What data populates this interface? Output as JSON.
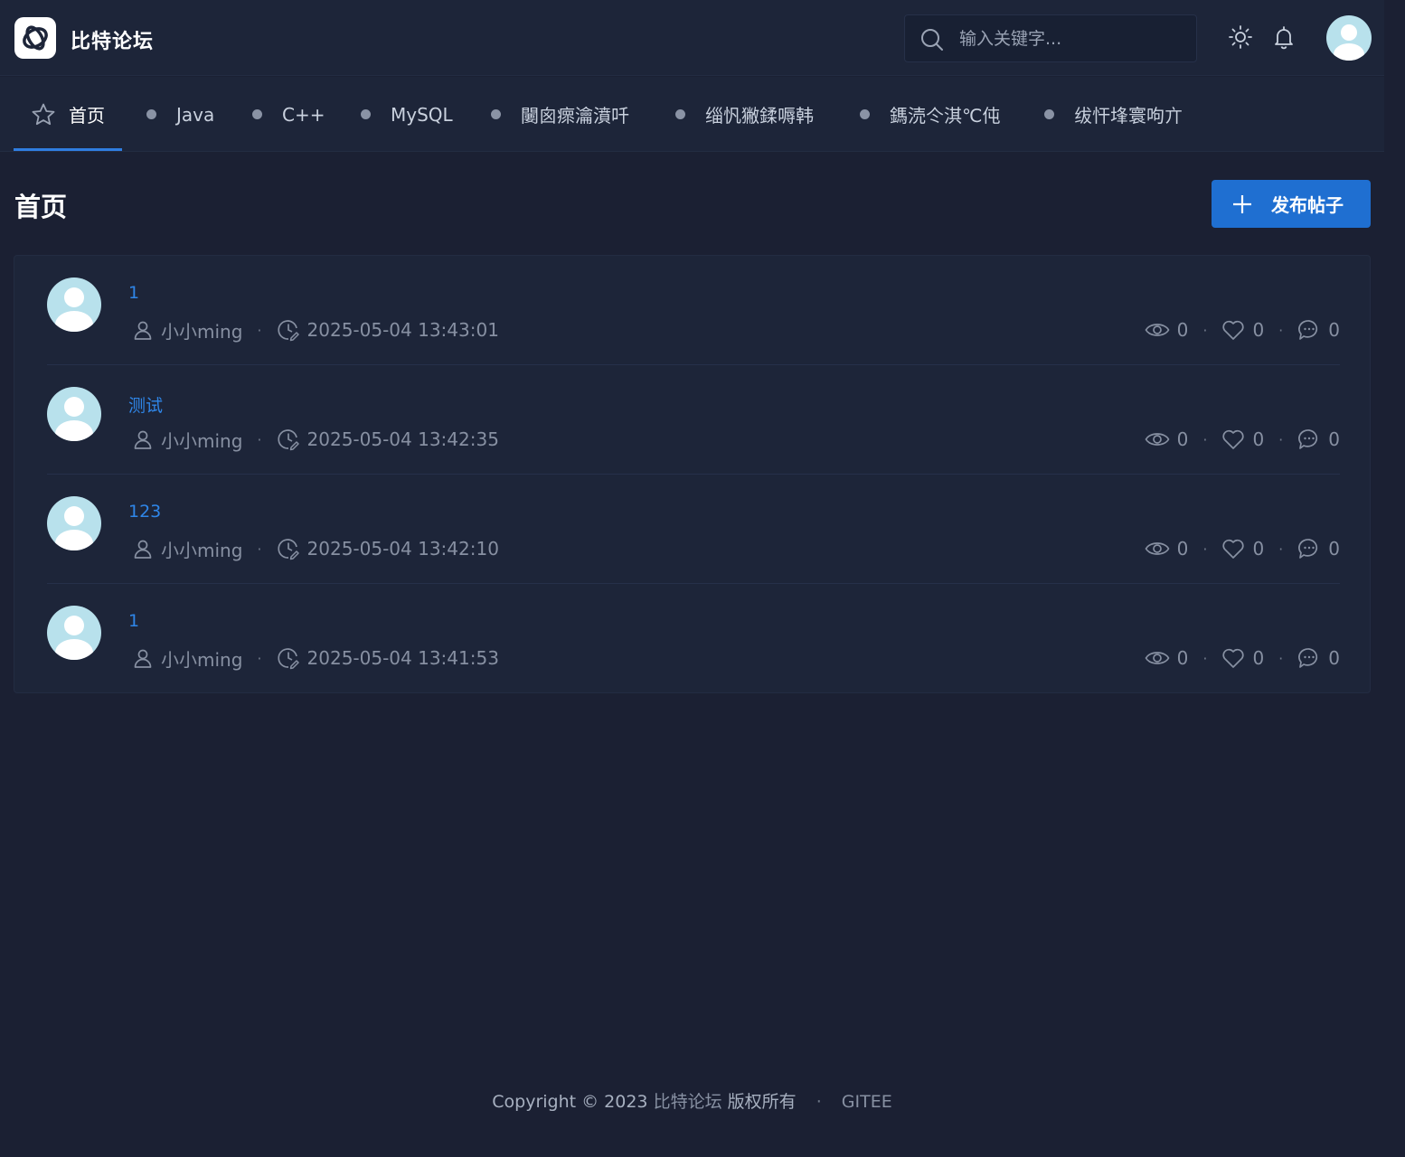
{
  "header": {
    "brand": "比特论坛",
    "search_placeholder": "输入关键字...",
    "icons": [
      "logo-icon",
      "search-icon",
      "sun-icon",
      "bell-icon",
      "avatar"
    ]
  },
  "nav": {
    "items": [
      {
        "label": "首页",
        "icon": "star-icon",
        "active": true
      },
      {
        "label": "Java"
      },
      {
        "label": "C++"
      },
      {
        "label": "MySQL"
      },
      {
        "label": "闄囪瘝瀹濆吀"
      },
      {
        "label": "缁忛獙鍒嗕韩"
      },
      {
        "label": "鎷涜仒淇℃伅"
      },
      {
        "label": "绂忓埄寰呴亣"
      }
    ]
  },
  "page": {
    "title": "首页",
    "publish_label": "发布帖子"
  },
  "posts": [
    {
      "title": "1",
      "author": "小小ming",
      "time": "2025-05-04 13:43:01",
      "views": "0",
      "likes": "0",
      "replies": "0"
    },
    {
      "title": "测试",
      "author": "小小ming",
      "time": "2025-05-04 13:42:35",
      "views": "0",
      "likes": "0",
      "replies": "0"
    },
    {
      "title": "123",
      "author": "小小ming",
      "time": "2025-05-04 13:42:10",
      "views": "0",
      "likes": "0",
      "replies": "0"
    },
    {
      "title": "1",
      "author": "小小ming",
      "time": "2025-05-04 13:41:53",
      "views": "0",
      "likes": "0",
      "replies": "0"
    }
  ],
  "footer": {
    "copyright": "Copyright © 2023",
    "brand": "比特论坛",
    "rights": "版权所有",
    "separator": "·",
    "gitee": "GITEE"
  },
  "colors": {
    "background": "#1b2033",
    "panel": "#1d2539",
    "accent": "#1f6fd1",
    "link": "#2f86e8"
  }
}
